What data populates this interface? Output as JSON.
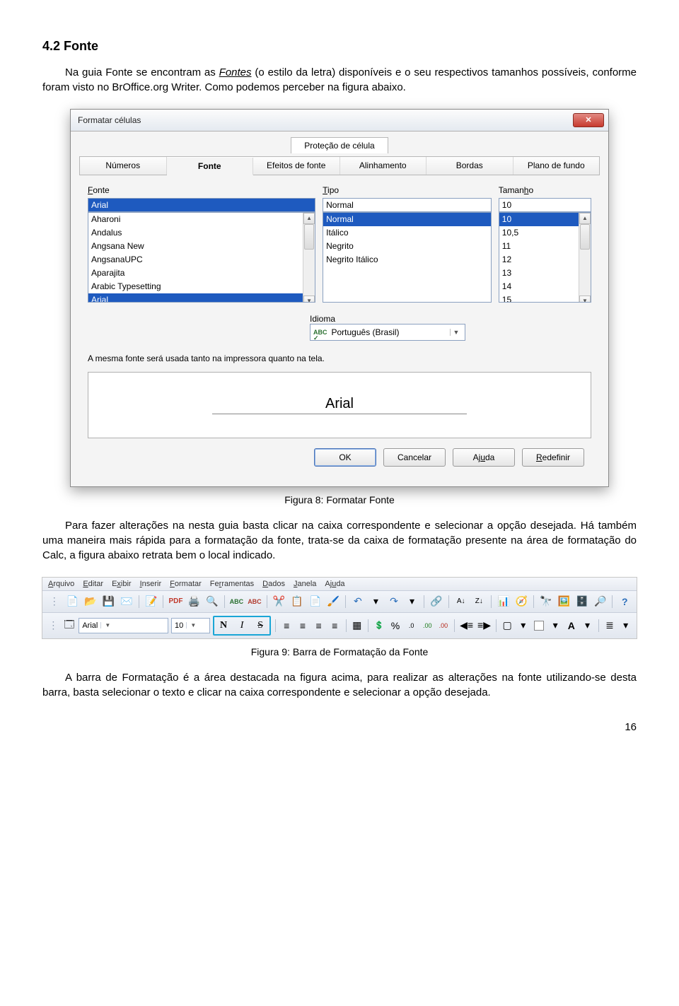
{
  "heading": "4.2 Fonte",
  "para1_a": "Na guia Fonte se encontram as ",
  "para1_link": "Fontes",
  "para1_b": " (o estilo da letra) disponíveis e o seu respectivos tamanhos possíveis, conforme foram visto no BrOffice.org Writer. Como podemos perceber na figura abaixo.",
  "caption1": "Figura 8: Formatar Fonte",
  "para2": "Para fazer alterações na nesta guia basta clicar na caixa correspondente e selecionar a opção desejada. Há também uma maneira mais rápida para a formatação da fonte, trata-se da caixa de formatação presente na área de formatação do Calc, a figura abaixo retrata bem o local indicado.",
  "caption2": "Figura 9: Barra de Formatação da Fonte",
  "para3": "A barra de Formatação é a área destacada na figura acima, para realizar as alterações na fonte utilizando-se desta barra, basta selecionar o texto e clicar na caixa correspondente e selecionar a opção desejada.",
  "page_number": "16",
  "dialog": {
    "title": "Formatar células",
    "top_tab": "Proteção de célula",
    "tabs": [
      "Números",
      "Fonte",
      "Efeitos de fonte",
      "Alinhamento",
      "Bordas",
      "Plano de fundo"
    ],
    "active_tab": 1,
    "col_font": {
      "label": "Fonte",
      "value": "Arial",
      "options": [
        "Aharoni",
        "Andalus",
        "Angsana New",
        "AngsanaUPC",
        "Aparajita",
        "Arabic Typesetting",
        "Arial"
      ],
      "selected": "Arial"
    },
    "col_type": {
      "label": "Tipo",
      "value": "Normal",
      "options": [
        "Normal",
        "Itálico",
        "Negrito",
        "Negrito Itálico"
      ],
      "selected": "Normal"
    },
    "col_size": {
      "label": "Tamanho",
      "value": "10",
      "options": [
        "10",
        "10,5",
        "11",
        "12",
        "13",
        "14",
        "15"
      ],
      "selected": "10"
    },
    "idioma_label": "Idioma",
    "idioma_value": "Português (Brasil)",
    "info_text": "A mesma fonte será usada tanto na impressora quanto na tela.",
    "preview": "Arial",
    "buttons": {
      "ok": "OK",
      "cancel": "Cancelar",
      "help": "Ajuda",
      "reset": "Redefinir"
    }
  },
  "toolbar": {
    "menus": [
      "Arquivo",
      "Editar",
      "Exibir",
      "Inserir",
      "Formatar",
      "Ferramentas",
      "Dados",
      "Janela",
      "Ajuda"
    ],
    "font_name": "Arial",
    "font_size": "10"
  }
}
